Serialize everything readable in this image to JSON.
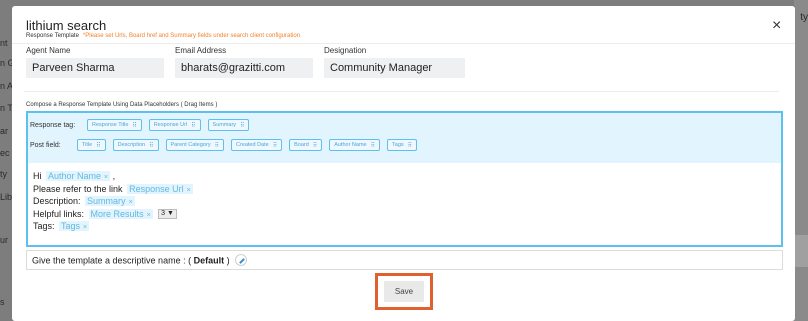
{
  "background": {
    "left_fragments": [
      "nt",
      "n G",
      "n A",
      "n T",
      "ar",
      "ec",
      "ty",
      "Lib",
      "ur",
      "s"
    ],
    "right_fragment": "ty"
  },
  "modal": {
    "title": "lithium search",
    "subtitle": "Response Template",
    "note": "*Please set Urls, Board href and Summary fields under search client configuration",
    "close_label": "×"
  },
  "agent": {
    "name_label": "Agent Name",
    "name_value": "Parveen Sharma",
    "email_label": "Email Address",
    "email_value": "bharats@grazitti.com",
    "designation_label": "Designation",
    "designation_value": "Community Manager"
  },
  "compose": {
    "label": "Compose a Response Template Using Data Placeholders ( Drag Items )",
    "response_tag_label": "Response tag:",
    "response_tags": [
      "Response Title",
      "Response Url",
      "Summary"
    ],
    "post_field_label": "Post field:",
    "post_fields": [
      "Title",
      "Description",
      "Parent Category",
      "Created Date",
      "Board",
      "Author Name",
      "Tags"
    ],
    "handle_icon": "⠿"
  },
  "template": {
    "line1_prefix": "Hi",
    "line1_tag": "Author Name",
    "line1_suffix": ",",
    "line2_prefix": "Please refer to the link",
    "line2_tag": "Response Url",
    "line3_prefix": "Description:",
    "line3_tag": "Summary",
    "line4_prefix": "Helpful links:",
    "line4_tag": "More Results",
    "line4_select": "3 ▼",
    "line5_prefix": "Tags:",
    "line5_tag": "Tags",
    "remove_glyph": "×"
  },
  "name_bar": {
    "prefix": "Give the template a descriptive name : (",
    "value": "Default",
    "suffix": ")"
  },
  "footer": {
    "save_label": "Save"
  },
  "colors": {
    "accent": "#5cc1ef",
    "highlight": "#e0612f",
    "note": "#f0822d"
  }
}
